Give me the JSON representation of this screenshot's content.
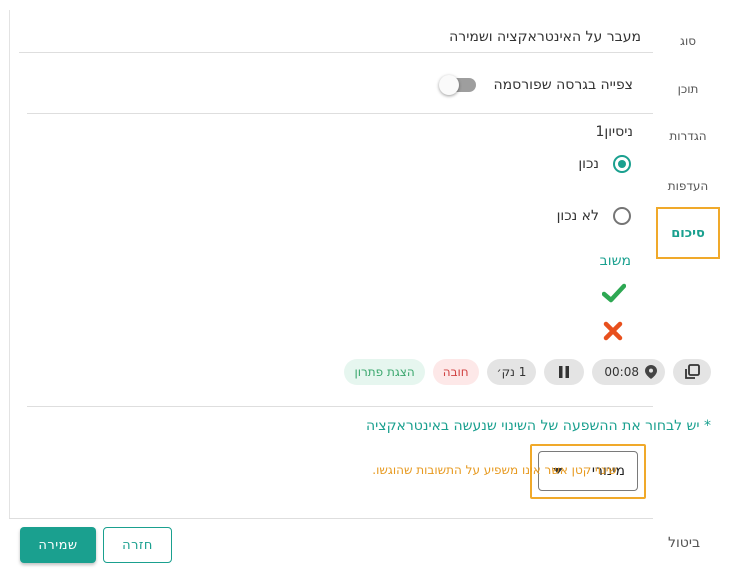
{
  "header": {
    "title": "מעבר על האינטראקציה ושמירה"
  },
  "toggle": {
    "label": "צפייה בגרסה שפורסמה",
    "on": false
  },
  "attempt": {
    "label": "ניסיון1"
  },
  "options": [
    {
      "label": "נכון",
      "checked": true
    },
    {
      "label": "לא נכון",
      "checked": false
    }
  ],
  "feedback": {
    "label": "משוב",
    "correct_icon": "check-icon",
    "wrong_icon": "x-icon"
  },
  "chips": {
    "time": "00:08",
    "points": "1 נק׳",
    "required": "חובה",
    "solution": "הצגת פתרון"
  },
  "impact": {
    "title": "* יש לבחור את ההשפעה של השינוי שנעשה באינטראקציה",
    "selected": "מינורי",
    "description": "שינוי קטן אשר אינו משפיע על התשובות שהוגשו."
  },
  "buttons": {
    "save": "שמירה",
    "back": "חזרה",
    "cancel": "ביטול"
  },
  "nav": [
    {
      "label": "סוג",
      "active": false
    },
    {
      "label": "תוכן",
      "active": false
    },
    {
      "label": "הגדרות",
      "active": false
    },
    {
      "label": "העדפות",
      "active": false
    },
    {
      "label": "סיכום",
      "active": true
    }
  ],
  "colors": {
    "accent": "#1aa08f",
    "highlight": "#f0a92a",
    "required": "#d14343",
    "solution": "#3aa76d",
    "wrong": "#e8501d"
  }
}
